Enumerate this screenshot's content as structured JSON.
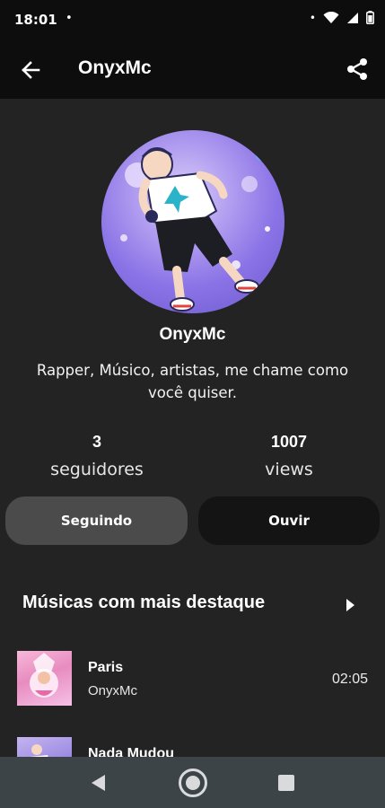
{
  "status_bar": {
    "time": "18:01",
    "dot": "•",
    "icons": [
      "notification-dot-icon",
      "wifi-icon",
      "signal-icon",
      "battery-icon"
    ]
  },
  "app_bar": {
    "title": "OnyxMc",
    "back_icon": "arrow-back-icon",
    "share_icon": "share-icon"
  },
  "profile": {
    "name": "OnyxMc",
    "bio": "Rapper, Músico, artistas, me chame como você quiser.",
    "followers_count": "3",
    "followers_label": "seguidores",
    "views_count": "1007",
    "views_label": "views",
    "following_button": "Seguindo",
    "listen_button": "Ouvir"
  },
  "featured": {
    "title": "Músicas com mais destaque",
    "tracks": [
      {
        "title": "Paris",
        "artist": "OnyxMc",
        "duration": "02:05"
      },
      {
        "title": "Nada Mudou",
        "artist": "",
        "duration": ""
      }
    ]
  },
  "nav_bar": {
    "icons": [
      "nav-back-icon",
      "nav-home-icon",
      "nav-recents-icon"
    ]
  },
  "colors": {
    "background": "#232323",
    "app_bar": "#0d0d0d",
    "following_button": "#4b4b4b",
    "listen_button": "#141414",
    "nav_bar": "#3c4448"
  }
}
